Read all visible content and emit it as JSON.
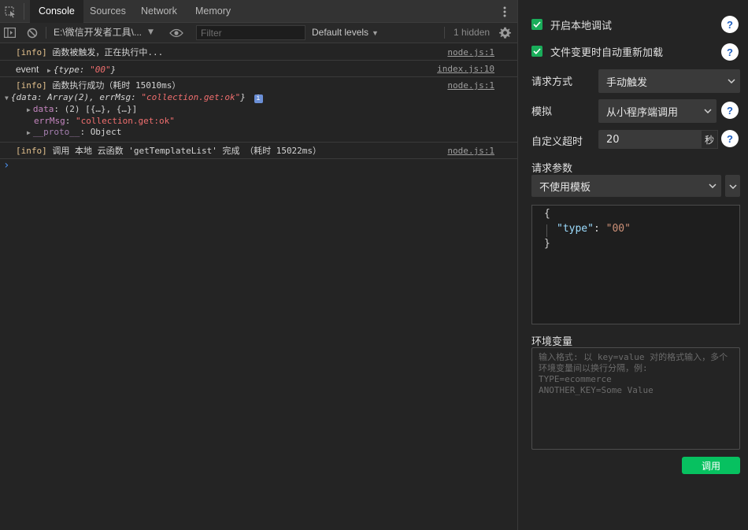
{
  "devtools": {
    "tabs": [
      {
        "label": "Console",
        "active": true
      },
      {
        "label": "Sources",
        "active": false
      },
      {
        "label": "Network",
        "active": false
      },
      {
        "label": "Memory",
        "active": false
      }
    ],
    "toolbar": {
      "context": "E:\\微信开发者工具\\...",
      "filter_placeholder": "Filter",
      "levels": "Default levels",
      "hidden": "1 hidden"
    },
    "logs": [
      {
        "tag": "[info]",
        "text": "函数被触发，正在执行中...",
        "source": "node.js:1"
      },
      {
        "label": "event",
        "preview": "{type: ",
        "value": "\"00\"",
        "close": "}",
        "source": "index.js:10"
      },
      {
        "tag": "[info]",
        "text": "函数执行成功（耗时 15010ms）",
        "source": "node.js:1",
        "object": {
          "summary_open": "{data: Array(2), errMsg: ",
          "summary_value": "\"collection.get:ok\"",
          "summary_close": "}",
          "data_key": "data",
          "data_value": "(2) [{…}, {…}]",
          "errmsg_key": "errMsg",
          "errmsg_value": "\"collection.get:ok\"",
          "proto_key": "__proto__",
          "proto_value": "Object"
        }
      },
      {
        "tag": "[info]",
        "text": "调用 本地 云函数 'getTemplateList' 完成  （耗时 15022ms）",
        "source": "node.js:1"
      }
    ],
    "prompt": "›"
  },
  "panel": {
    "local_debug": {
      "label": "开启本地调试",
      "checked": true
    },
    "auto_reload": {
      "label": "文件变更时自动重新加载",
      "checked": true
    },
    "request_method": {
      "label": "请求方式",
      "value": "手动触发"
    },
    "simulate": {
      "label": "模拟",
      "value": "从小程序端调用"
    },
    "timeout": {
      "label": "自定义超时",
      "value": "20",
      "unit": "秒"
    },
    "params": {
      "label": "请求参数",
      "template": "不使用模板"
    },
    "editor": {
      "line1": "{",
      "key": "\"type\"",
      "colon": ": ",
      "value": "\"00\"",
      "line3": "}"
    },
    "env": {
      "label": "环境变量",
      "placeholder": "输入格式: 以 key=value 对的格式输入，多个环境变量间以换行分隔，例:\nTYPE=ecommerce\nANOTHER_KEY=Some Value"
    },
    "call_button": "调用",
    "help_icon": "?"
  },
  "colors": {
    "accent": "#07c160",
    "checkbox": "#1aad5a",
    "help": "#1f5fbf"
  }
}
